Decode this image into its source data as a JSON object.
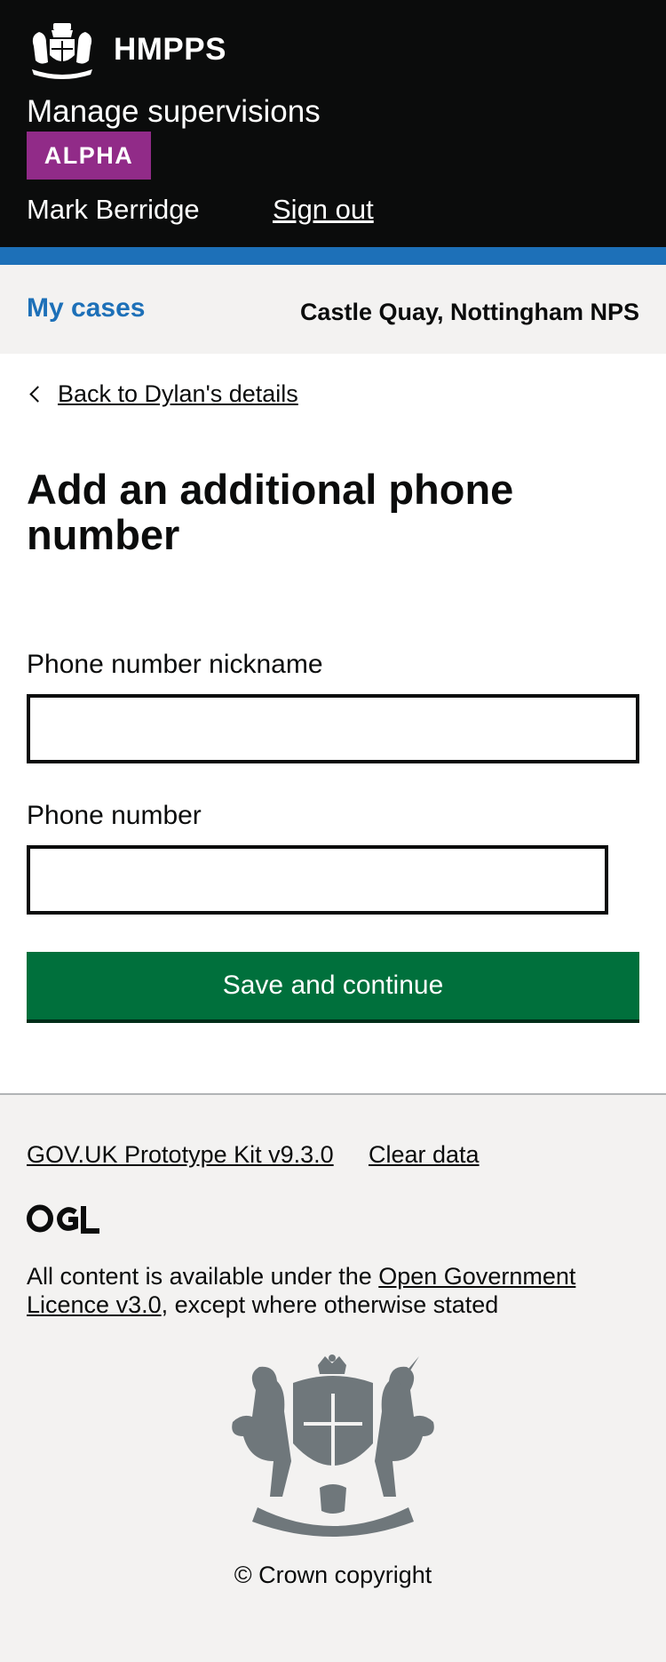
{
  "header": {
    "brand": "HMPPS",
    "service_name": "Manage supervisions",
    "phase_tag": "ALPHA",
    "user_name": "Mark Berridge",
    "sign_out": "Sign out"
  },
  "subnav": {
    "my_cases": "My cases",
    "location": "Castle Quay, Nottingham NPS"
  },
  "main": {
    "back_link": "Back to Dylan's details",
    "title": "Add an additional phone number",
    "fields": [
      {
        "label": "Phone number nickname",
        "value": "",
        "placeholder": ""
      },
      {
        "label": "Phone number",
        "value": "",
        "placeholder": ""
      }
    ],
    "submit": "Save and continue"
  },
  "footer": {
    "kit_link": "GOV.UK Prototype Kit v9.3.0",
    "clear_data": "Clear data",
    "ogl_logo": "OGL",
    "licence_prefix": "All content is available under the ",
    "licence_link": "Open Government Licence v3.0",
    "licence_suffix": ", except where otherwise stated",
    "copyright": "© Crown copyright"
  },
  "colors": {
    "header_bg": "#0b0c0c",
    "link_blue": "#1d70b8",
    "alpha_purple": "#912b88",
    "button_green": "#00703c",
    "footer_bg": "#f3f2f1"
  },
  "icons": [
    "crown-crest-icon",
    "chevron-left-icon",
    "ogl-logo-icon",
    "royal-coat-of-arms-icon"
  ]
}
